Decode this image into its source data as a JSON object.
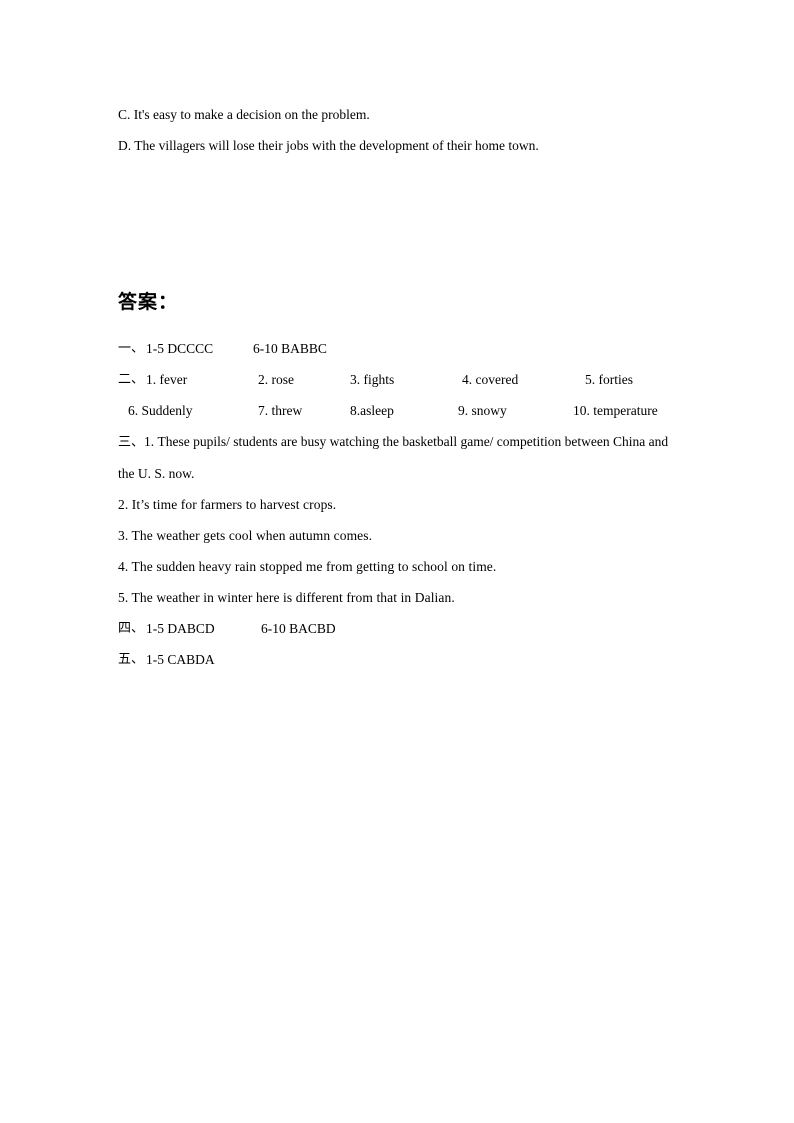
{
  "document": {
    "options": [
      "C. It's easy to make a decision on the problem.",
      "D. The villagers will lose their jobs with the development of their home town."
    ],
    "answer_heading": "答案：",
    "section_one": {
      "marker": "一、",
      "col1": "1-5 DCCCC",
      "col2": "6-10 BABBC"
    },
    "section_two": {
      "marker": "二、",
      "row1": [
        "1. fever",
        "2. rose",
        "3. fights",
        "4. covered",
        "5. forties"
      ],
      "row2": [
        "6. Suddenly",
        "7. threw",
        "8.asleep",
        "9. snowy",
        "10. temperature"
      ]
    },
    "section_three": {
      "marker": "三、",
      "items": [
        "1. These pupils/ students are busy watching the basketball game/ competition between China and the U. S. now.",
        "2. It’s time for farmers to harvest crops.",
        "3. The weather gets cool when autumn comes.",
        "4. The sudden heavy rain stopped me from getting to school on time.",
        "5. The weather in winter here is different from that in Dalian."
      ]
    },
    "section_four": {
      "marker": "四、",
      "col1": "1-5 DABCD",
      "col2": "6-10 BACBD"
    },
    "section_five": {
      "marker": "五、",
      "col1": "1-5 CABDA"
    }
  }
}
